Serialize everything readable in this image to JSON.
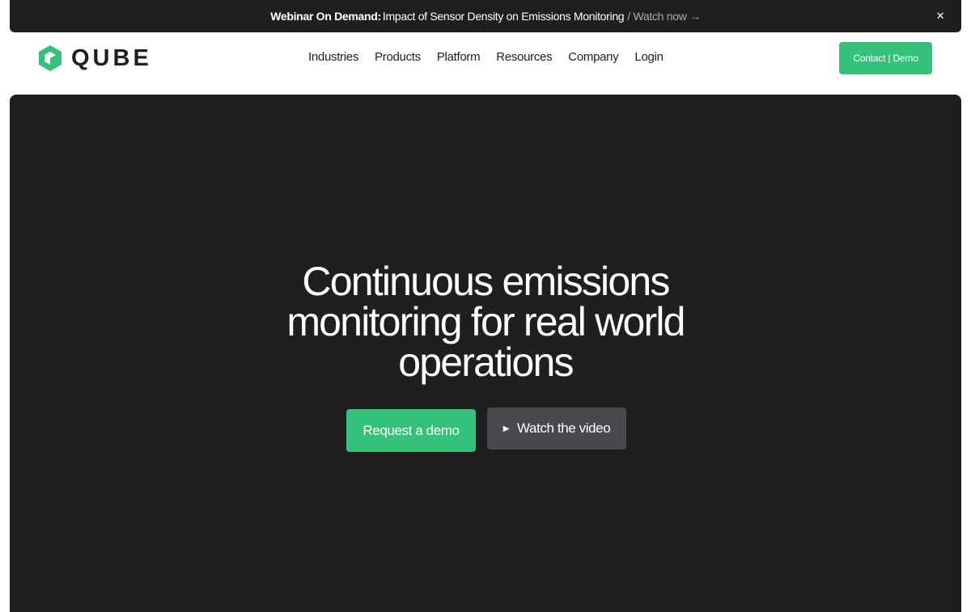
{
  "announcement": {
    "label": "Webinar On Demand:",
    "text": "Impact of Sensor Density on Emissions Monitoring",
    "link": "/ Watch now →",
    "close": "✕"
  },
  "header": {
    "logo_text": "QUBE",
    "nav": [
      "Industries",
      "Products",
      "Platform",
      "Resources",
      "Company",
      "Login"
    ],
    "contact_button": "Contact | Demo"
  },
  "hero": {
    "title_lines": [
      "Continuous emissions",
      "monitoring for real world",
      "operations"
    ],
    "primary_button": "Request a demo",
    "secondary_button": "Watch the video",
    "play_icon": "▶"
  },
  "colors": {
    "brand_green": "#34c17a",
    "dark": "#1e1f21",
    "secondary_button": "#48494c"
  },
  "icons": {
    "logo": "qube-hexagon-logo-icon",
    "close": "close-icon",
    "play": "play-icon"
  }
}
